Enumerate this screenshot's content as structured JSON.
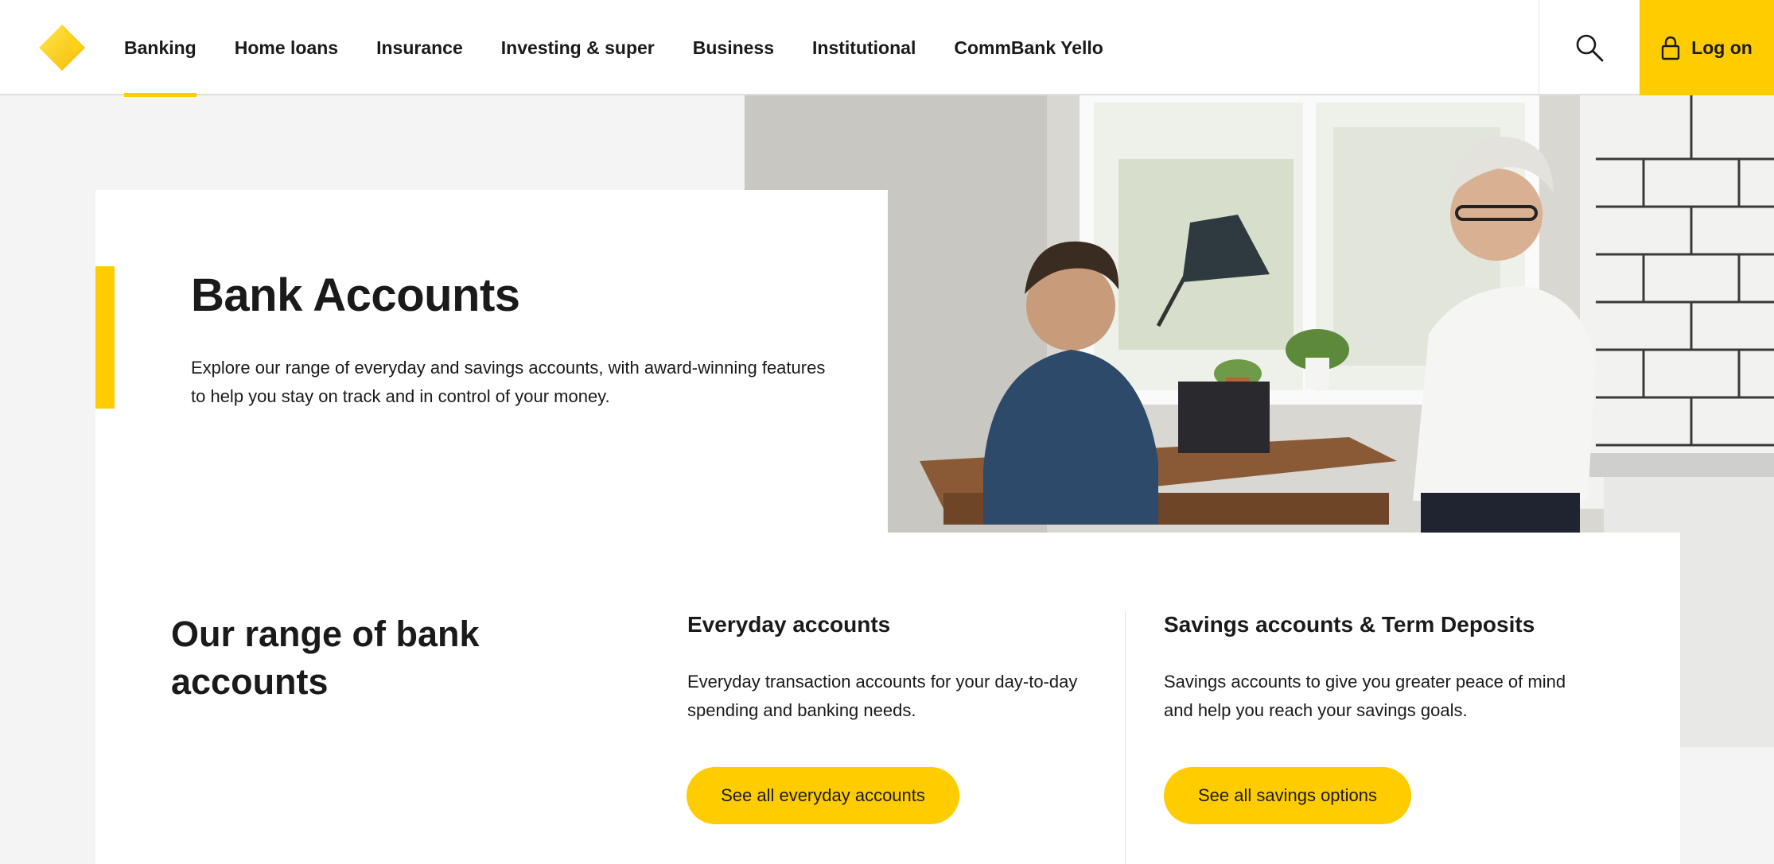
{
  "header": {
    "nav": [
      "Banking",
      "Home loans",
      "Insurance",
      "Investing & super",
      "Business",
      "Institutional",
      "CommBank Yello"
    ],
    "active_nav": "Banking",
    "login_label": "Log on"
  },
  "hero": {
    "title": "Bank Accounts",
    "description": "Explore our range of everyday and savings accounts, with award-winning features to help you stay on track and in control of your money."
  },
  "range": {
    "title": "Our range of bank accounts",
    "everyday": {
      "title": "Everyday accounts",
      "description": "Everyday transaction accounts for your day-to-day spending and banking needs.",
      "button": "See all everyday accounts"
    },
    "savings": {
      "title": "Savings accounts & Term Deposits",
      "description": "Savings accounts to give you greater peace of mind and help you reach your savings goals.",
      "button": "See all savings options"
    }
  },
  "colors": {
    "brand_yellow": "#ffcc00",
    "text": "#1a1a1a",
    "page_bg": "#f4f4f4"
  },
  "icons": [
    "commbank-logo-icon",
    "search-icon",
    "lock-icon"
  ]
}
